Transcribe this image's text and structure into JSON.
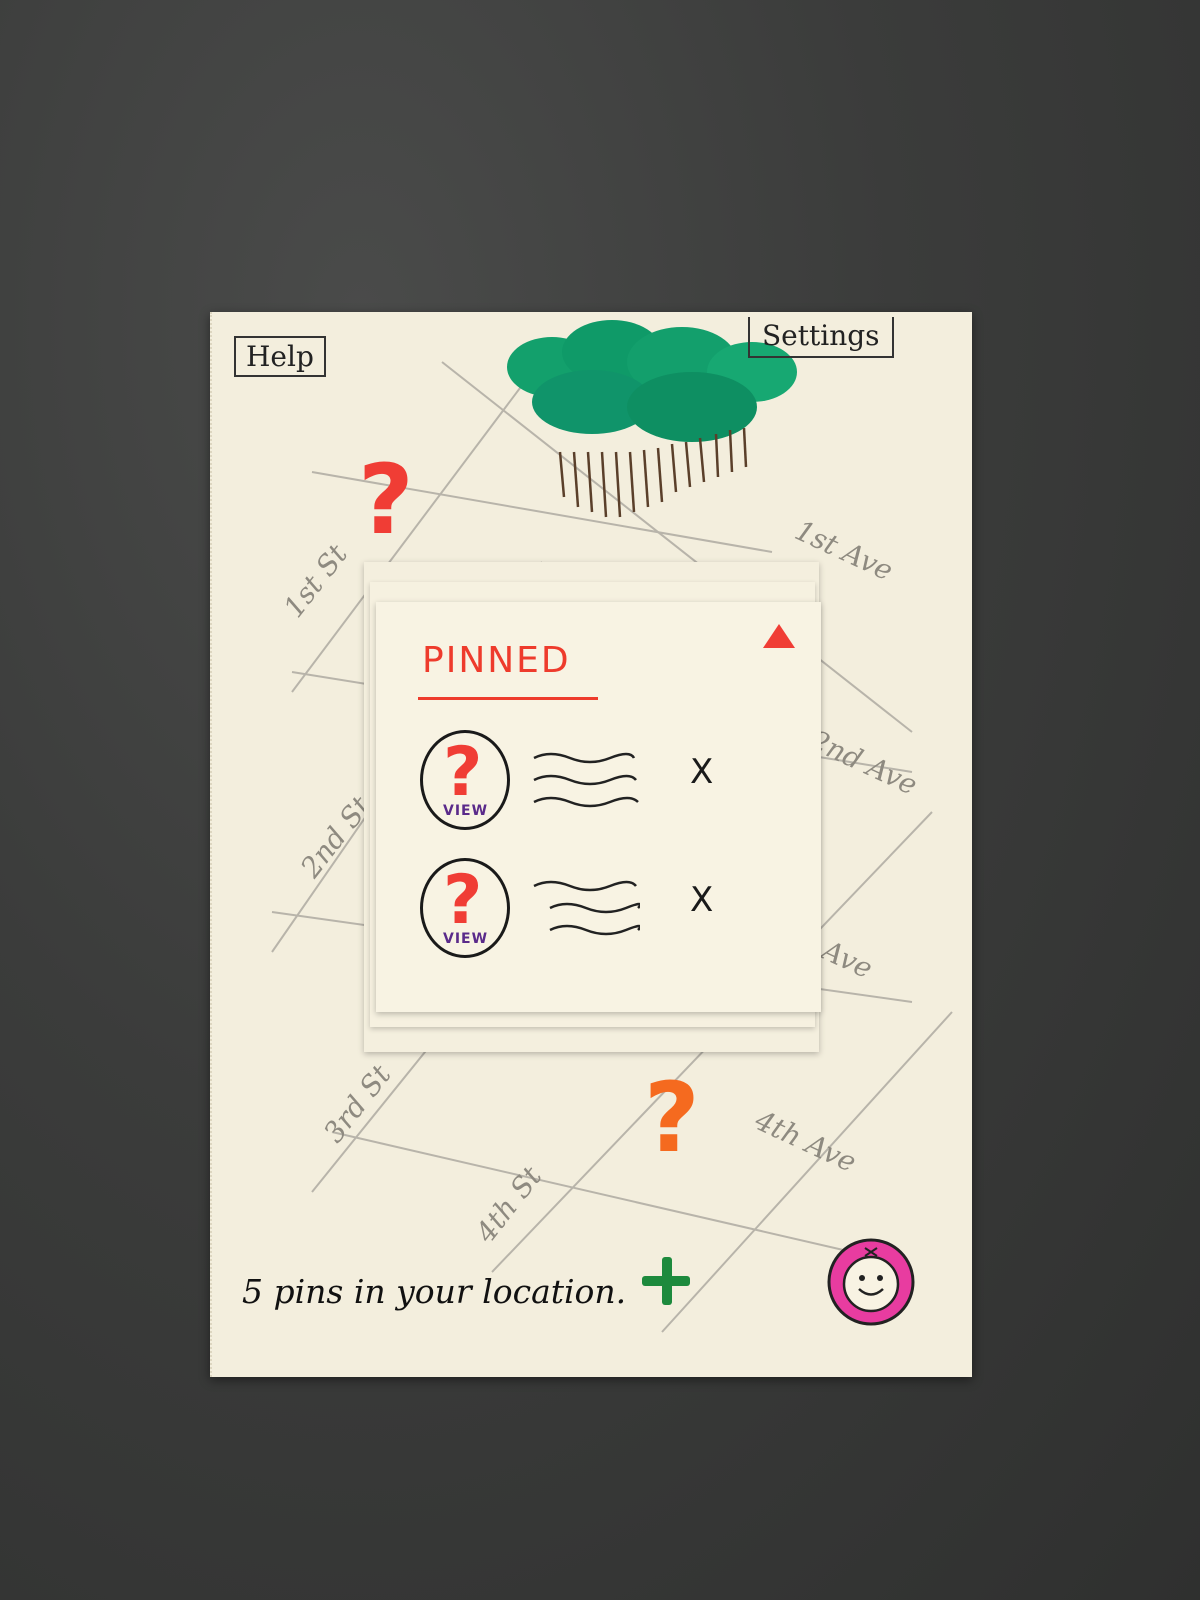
{
  "header": {
    "help_label": "Help",
    "settings_label": "Settings"
  },
  "map": {
    "streets": [
      {
        "label": "1st St"
      },
      {
        "label": "2nd St"
      },
      {
        "label": "3rd St"
      },
      {
        "label": "4th St"
      }
    ],
    "avenues": [
      {
        "label": "1st Ave"
      },
      {
        "label": "2nd Ave"
      },
      {
        "label": "Ave"
      },
      {
        "label": "4th Ave"
      }
    ],
    "weather_icon": "rain-cloud-icon",
    "pins": [
      {
        "glyph": "?",
        "color": "#f03d35"
      },
      {
        "glyph": "?",
        "color": "#f56a1f"
      }
    ]
  },
  "pinned_panel": {
    "title": "PINNED",
    "items": [
      {
        "thumb_glyph": "?",
        "view_label": "VIEW",
        "remove_label": "X"
      },
      {
        "thumb_glyph": "?",
        "view_label": "VIEW",
        "remove_label": "X"
      }
    ],
    "collapse_icon": "triangle-up-icon"
  },
  "footer": {
    "status": "5 pins in your location.",
    "add_icon": "plus-icon",
    "profile_icon": "smiley-avatar-icon"
  },
  "colors": {
    "accent_red": "#f03d35",
    "accent_orange": "#f56a1f",
    "add_green": "#1d8a3d",
    "avatar_pink": "#e83ca0",
    "cloud_green": "#129b6a"
  }
}
